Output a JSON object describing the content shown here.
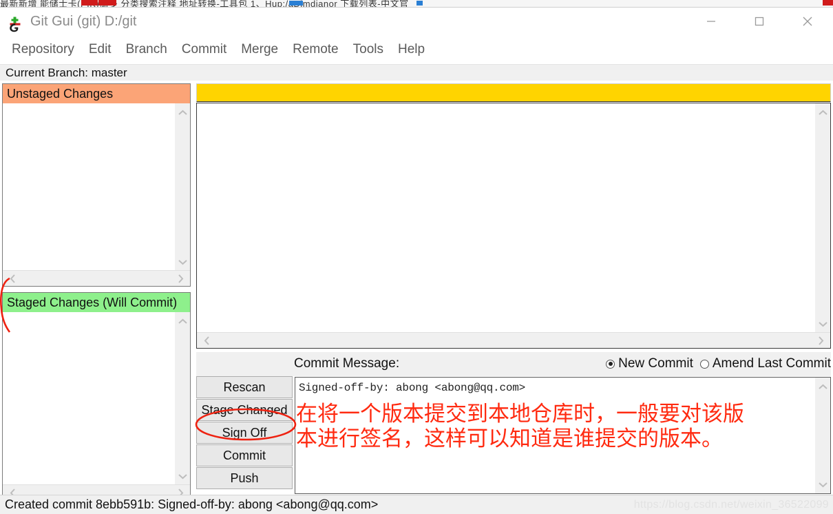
{
  "background_strip": {
    "text": "最新新增    能储士卡(PIK)储多      分类搜索注释    地址转换-工具包     1、Hup:/aDimdianor      下载列表-中文官"
  },
  "window": {
    "title": "Git Gui (git) D:/git",
    "icon": "git-gui-icon",
    "controls": {
      "minimize": "minimize-icon",
      "maximize": "maximize-icon",
      "close": "close-icon"
    }
  },
  "menubar": {
    "items": [
      {
        "label": "Repository"
      },
      {
        "label": "Edit"
      },
      {
        "label": "Branch"
      },
      {
        "label": "Commit"
      },
      {
        "label": "Merge"
      },
      {
        "label": "Remote"
      },
      {
        "label": "Tools"
      },
      {
        "label": "Help"
      }
    ]
  },
  "branch_bar": {
    "text": "Current Branch: master"
  },
  "panels": {
    "unstaged": {
      "title": "Unstaged Changes",
      "header_color": "#fba477",
      "items": []
    },
    "staged": {
      "title": "Staged Changes (Will Commit)",
      "header_color": "#8ef08c",
      "items": []
    }
  },
  "diff": {
    "header_color": "#ffd400",
    "header_text": "",
    "content": ""
  },
  "commit": {
    "message_label": "Commit Message:",
    "mode_options": [
      {
        "label": "New Commit",
        "selected": true
      },
      {
        "label": "Amend Last Commit",
        "selected": false
      }
    ],
    "message_value": "Signed-off-by: abong <abong@qq.com>",
    "buttons": [
      {
        "label": "Rescan"
      },
      {
        "label": "Stage Changed"
      },
      {
        "label": "Sign Off"
      },
      {
        "label": "Commit"
      },
      {
        "label": "Push"
      }
    ]
  },
  "annotation": {
    "text": "在将一个版本提交到本地仓库时，一般要对该版\n本进行签名，这样可以知道是谁提交的版本。",
    "color": "#ff2a10",
    "highlight_target": "Sign Off"
  },
  "status_bar": {
    "text": "Created commit 8ebb591b: Signed-off-by: abong <abong@qq.com>"
  },
  "watermark": {
    "text": "https://blog.csdn.net/weixin_36522099"
  }
}
